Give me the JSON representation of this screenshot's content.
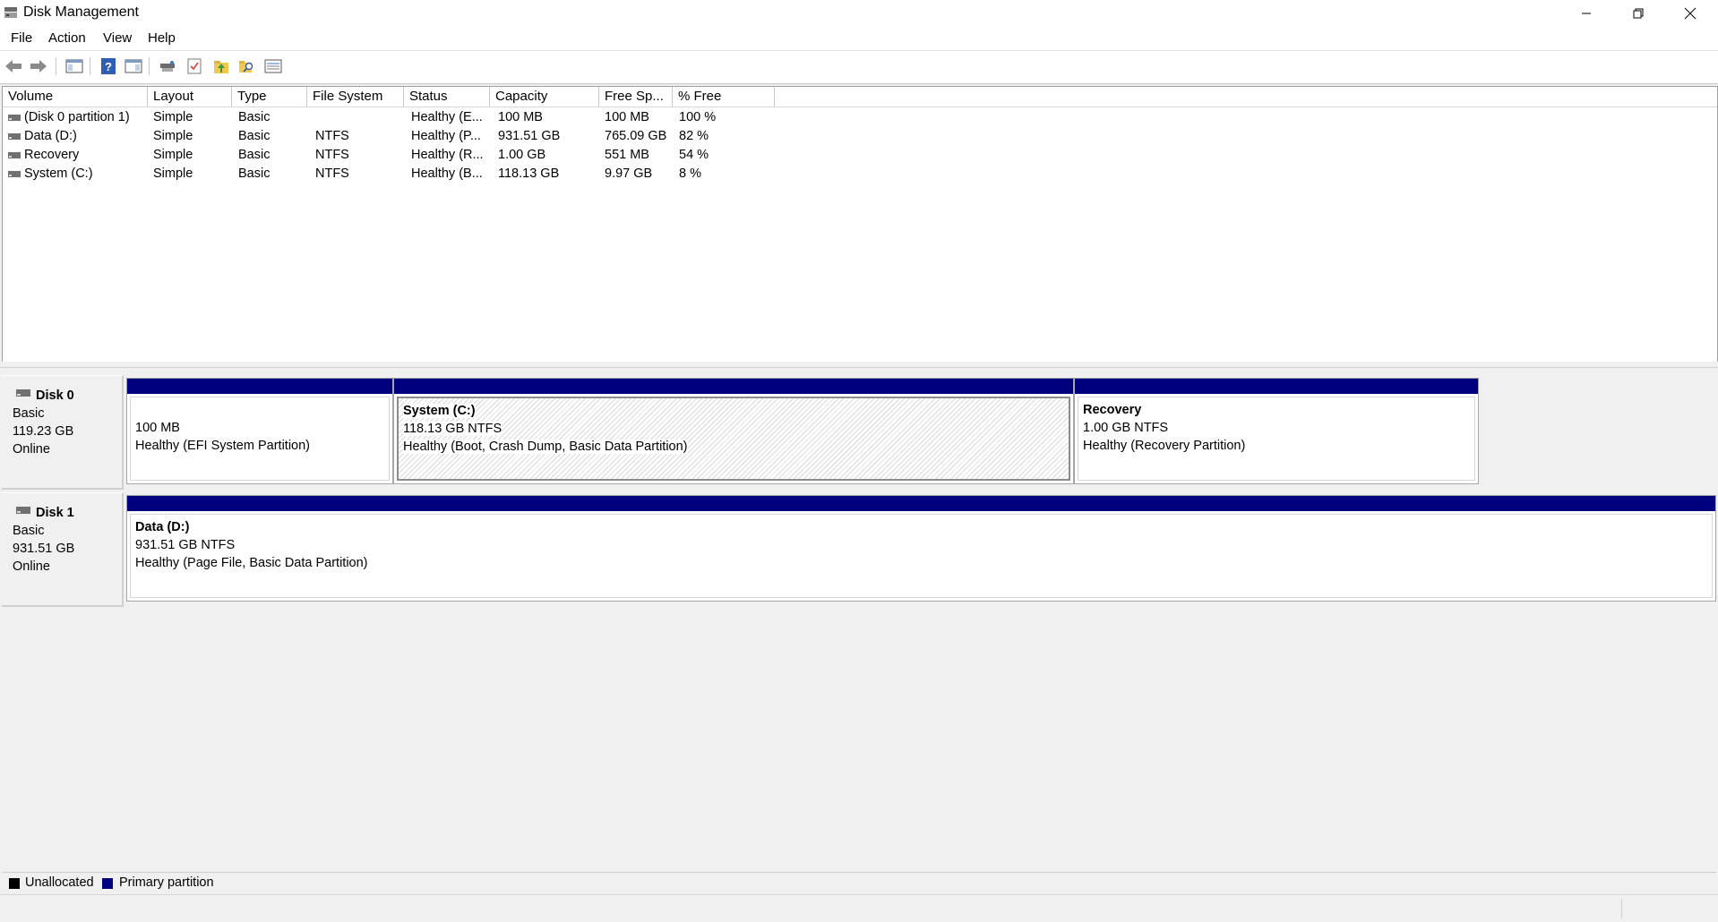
{
  "window": {
    "title": "Disk Management"
  },
  "menu": [
    "File",
    "Action",
    "View",
    "Help"
  ],
  "toolbar_icons": [
    "back-icon",
    "forward-icon",
    "console-tree-icon",
    "help-icon",
    "properties-pane-icon",
    "connect-icon",
    "checklist-icon",
    "up-folder-icon",
    "search-folder-icon",
    "list-view-icon"
  ],
  "volume_list": {
    "columns": [
      "Volume",
      "Layout",
      "Type",
      "File System",
      "Status",
      "Capacity",
      "Free Sp...",
      "% Free"
    ],
    "rows": [
      [
        "(Disk 0 partition 1)",
        "Simple",
        "Basic",
        "",
        "Healthy (E...",
        "100 MB",
        "100 MB",
        "100 %"
      ],
      [
        "Data (D:)",
        "Simple",
        "Basic",
        "NTFS",
        "Healthy (P...",
        "931.51 GB",
        "765.09 GB",
        "82 %"
      ],
      [
        "Recovery",
        "Simple",
        "Basic",
        "NTFS",
        "Healthy (R...",
        "1.00 GB",
        "551 MB",
        "54 %"
      ],
      [
        "System (C:)",
        "Simple",
        "Basic",
        "NTFS",
        "Healthy (B...",
        "118.13 GB",
        "9.97 GB",
        "8 %"
      ]
    ]
  },
  "disks": [
    {
      "name": "Disk 0",
      "type": "Basic",
      "size": "119.23 GB",
      "state": "Online",
      "partitions": [
        {
          "name": "",
          "size": "100 MB",
          "status": "Healthy (EFI System Partition)"
        },
        {
          "name": "System  (C:)",
          "size": "118.13 GB NTFS",
          "status": "Healthy (Boot, Crash Dump, Basic Data Partition)"
        },
        {
          "name": "Recovery",
          "size": "1.00 GB NTFS",
          "status": "Healthy (Recovery Partition)"
        }
      ]
    },
    {
      "name": "Disk 1",
      "type": "Basic",
      "size": "931.51 GB",
      "state": "Online",
      "partitions": [
        {
          "name": "Data  (D:)",
          "size": "931.51 GB NTFS",
          "status": "Healthy (Page File, Basic Data Partition)"
        }
      ]
    }
  ],
  "legend": [
    {
      "label": "Unallocated",
      "color": "#000000"
    },
    {
      "label": "Primary partition",
      "color": "#00007f"
    }
  ],
  "colors": {
    "partition_bar": "#00007f",
    "window_bg": "#f0f0f0"
  }
}
